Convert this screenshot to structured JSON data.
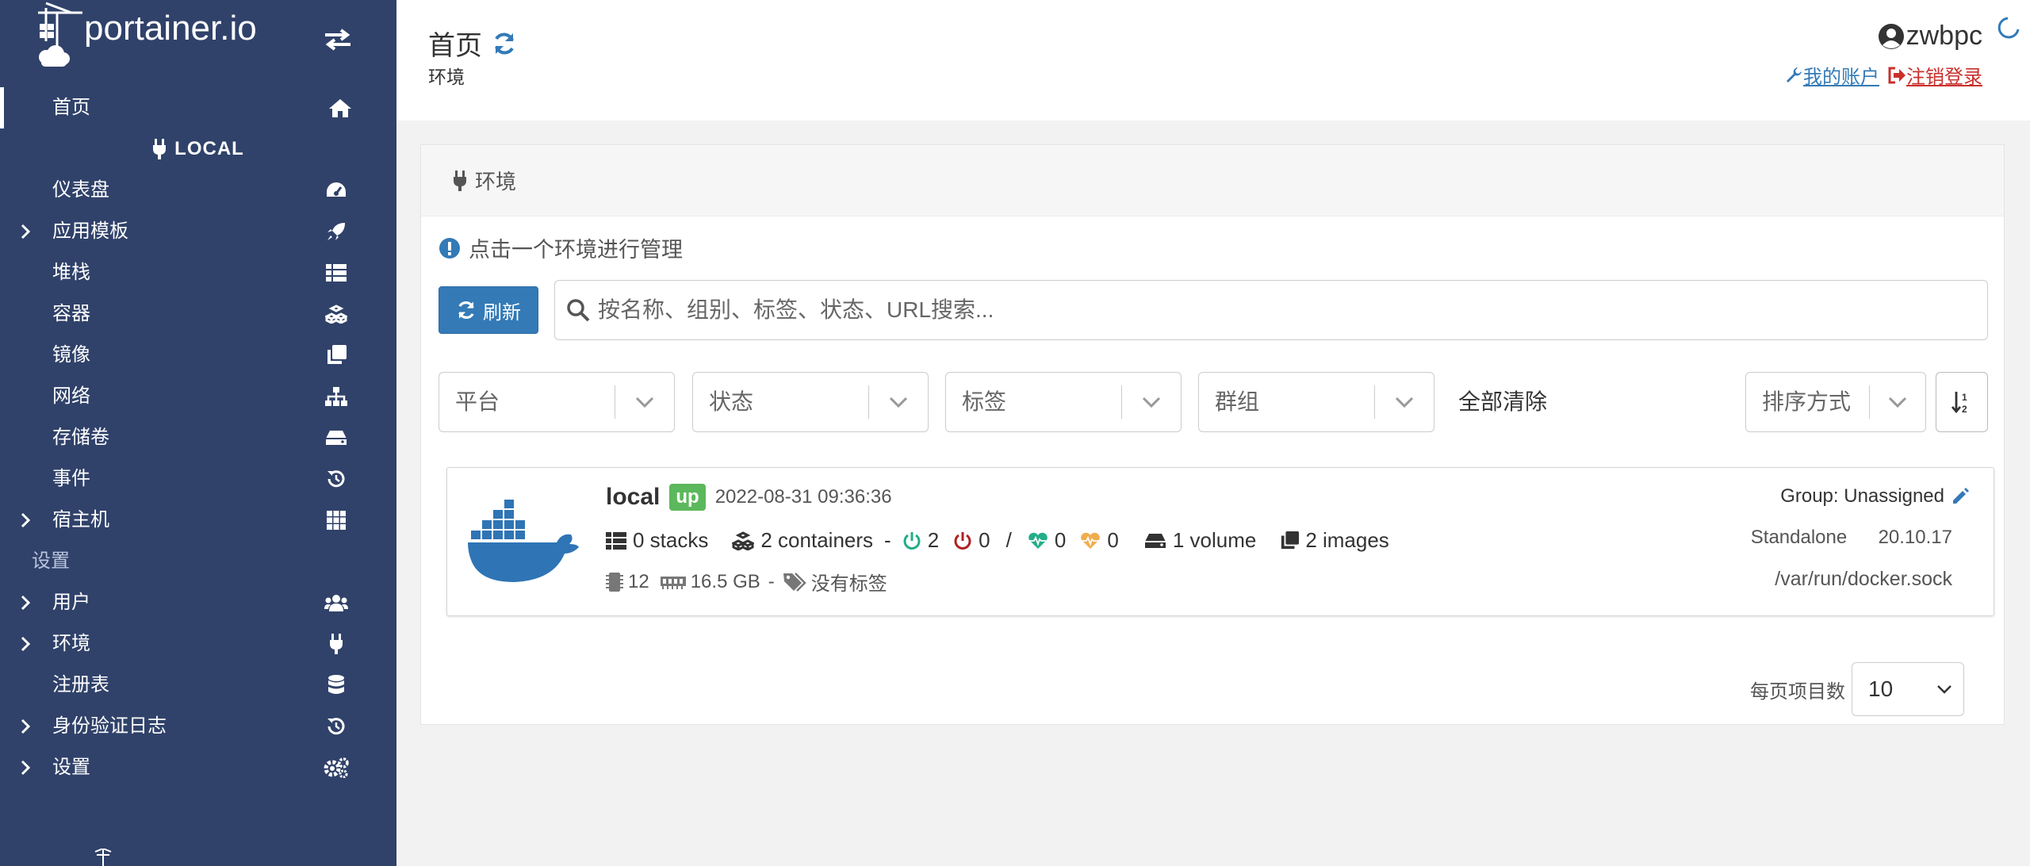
{
  "app": {
    "brand": "portainer.io"
  },
  "sidebar": {
    "home_label": "首页",
    "local_label": "LOCAL",
    "items": [
      {
        "label": "仪表盘",
        "icon": "tachometer-icon",
        "expandable": false
      },
      {
        "label": "应用模板",
        "icon": "rocket-icon",
        "expandable": true
      },
      {
        "label": "堆栈",
        "icon": "th-list-icon",
        "expandable": false
      },
      {
        "label": "容器",
        "icon": "cubes-icon",
        "expandable": false
      },
      {
        "label": "镜像",
        "icon": "clone-icon",
        "expandable": false
      },
      {
        "label": "网络",
        "icon": "sitemap-icon",
        "expandable": false
      },
      {
        "label": "存储卷",
        "icon": "hdd-icon",
        "expandable": false
      },
      {
        "label": "事件",
        "icon": "history-icon",
        "expandable": false
      },
      {
        "label": "宿主机",
        "icon": "th-icon",
        "expandable": true
      }
    ],
    "settings_section": "设置",
    "settings_items": [
      {
        "label": "用户",
        "icon": "users-icon",
        "expandable": true
      },
      {
        "label": "环境",
        "icon": "plug-icon",
        "expandable": true
      },
      {
        "label": "注册表",
        "icon": "database-icon",
        "expandable": false
      },
      {
        "label": "身份验证日志",
        "icon": "history-icon",
        "expandable": true
      },
      {
        "label": "设置",
        "icon": "cogs-icon",
        "expandable": true
      }
    ]
  },
  "header": {
    "title": "首页",
    "subtitle": "环境",
    "username": "zwbpc",
    "my_account": "我的账户",
    "logout": "注销登录"
  },
  "panel": {
    "title": "环境",
    "hint": "点击一个环境进行管理",
    "refresh_label": "刷新",
    "search_placeholder": "按名称、组别、标签、状态、URL搜索...",
    "filters": [
      "平台",
      "状态",
      "标签",
      "群组"
    ],
    "clear_all": "全部清除",
    "sort_placeholder": "排序方式",
    "environment": {
      "name": "local",
      "status": "up",
      "timestamp": "2022-08-31 09:36:36",
      "stacks": "0 stacks",
      "containers": "2 containers",
      "running": "2",
      "stopped": "0",
      "healthy": "0",
      "unhealthy": "0",
      "volumes": "1 volume",
      "images": "2 images",
      "cpu": "12",
      "memory": "16.5 GB",
      "tags": "没有标签",
      "group": "Group: Unassigned",
      "type": "Standalone",
      "version": "20.10.17",
      "url": "/var/run/docker.sock"
    },
    "per_page_label": "每页项目数",
    "per_page_value": "10"
  },
  "colors": {
    "sidebar_bg": "#30426a",
    "primary": "#337ab7",
    "success": "#5cb85c",
    "danger": "#c9302c",
    "running": "#23ae89",
    "stopped": "#ae2323",
    "unhealthy": "#f0ad4e",
    "docker_blue": "#2f74b5"
  }
}
